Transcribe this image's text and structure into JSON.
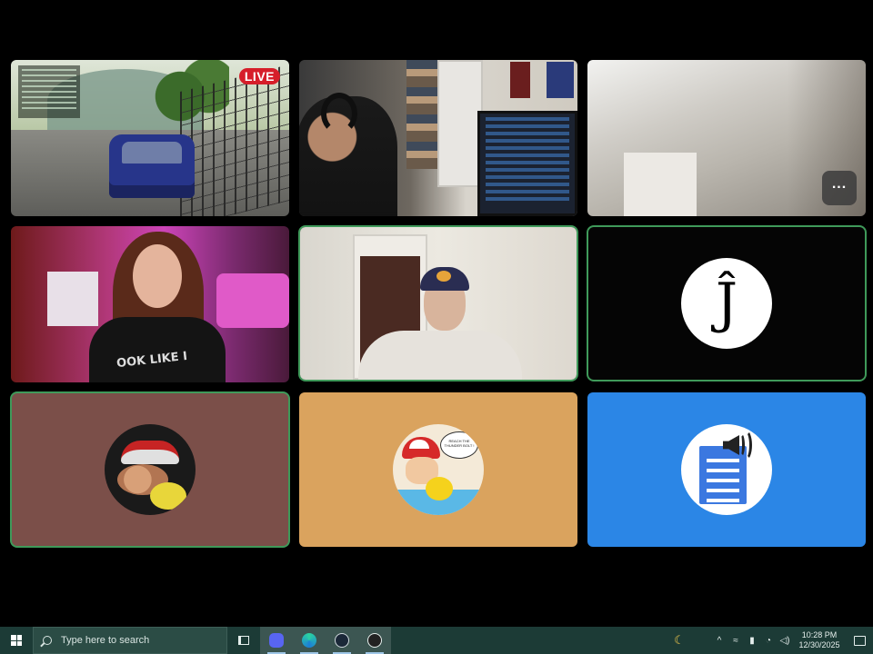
{
  "tiles": {
    "game": {
      "live_badge": "LIVE"
    },
    "ceiling": {
      "more_button": "..."
    },
    "j_avatar": {
      "letter": "Ĵ"
    },
    "pokemon_avatar": {
      "bubble_text": "REACH THE THUNDER BOLT !"
    }
  },
  "taskbar": {
    "search_placeholder": "Type here to search",
    "clock_time": "10:28 PM",
    "clock_date": "12/30/2025",
    "apps": [
      "task-view",
      "discord",
      "edge",
      "steam",
      "obs"
    ]
  },
  "colors": {
    "active_speaker_border": "#3f9a5a",
    "taskbar_bg": "#1c3b36",
    "tile_pink_brown": "#7b4f49",
    "tile_tan": "#daa35e",
    "tile_blue": "#2b86e6"
  }
}
